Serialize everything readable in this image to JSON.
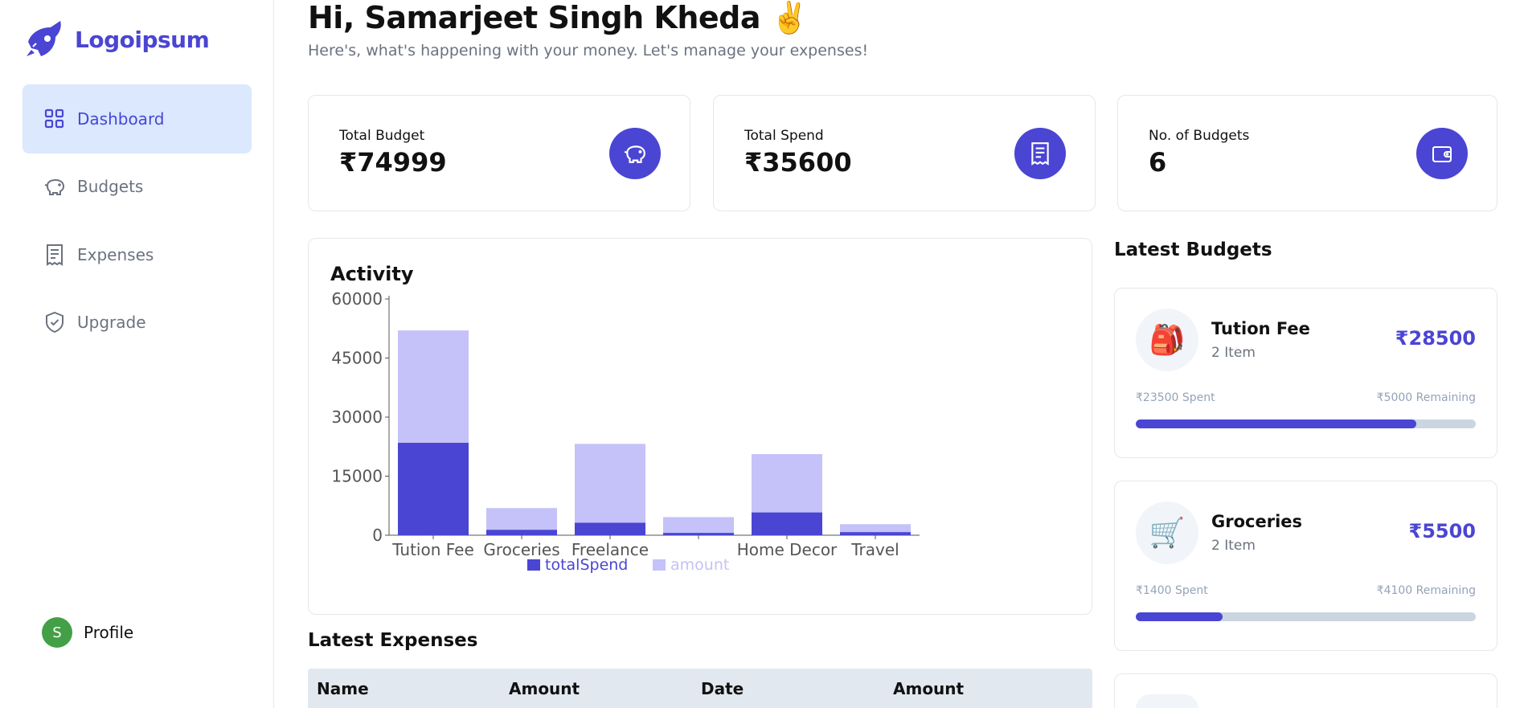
{
  "sidebar": {
    "logo_text": "Logoipsum",
    "nav": [
      {
        "label": "Dashboard",
        "icon": "grid-icon",
        "active": true
      },
      {
        "label": "Budgets",
        "icon": "piggy-bank-icon",
        "active": false
      },
      {
        "label": "Expenses",
        "icon": "receipt-icon",
        "active": false
      },
      {
        "label": "Upgrade",
        "icon": "shield-check-icon",
        "active": false
      }
    ],
    "profile": {
      "initial": "S",
      "label": "Profile"
    }
  },
  "header": {
    "greeting": "Hi, Samarjeet Singh Kheda ✌️",
    "subtitle": "Here's, what's happening with your money. Let's manage your expenses!"
  },
  "stats": [
    {
      "label": "Total Budget",
      "value": "₹74999",
      "icon": "piggy-bank-icon"
    },
    {
      "label": "Total Spend",
      "value": "₹35600",
      "icon": "receipt-icon"
    },
    {
      "label": "No. of Budgets",
      "value": "6",
      "icon": "wallet-icon"
    }
  ],
  "colors": {
    "accent": "#4a45d3",
    "accent_light": "#c4c2f8",
    "active_bg": "#dbe8fe"
  },
  "activity": {
    "title": "Activity"
  },
  "chart_data": {
    "type": "bar",
    "stacked": true,
    "categories": [
      "Tution Fee",
      "Groceries",
      "Freelance",
      "",
      "Home Decor",
      "Travel"
    ],
    "series": [
      {
        "name": "totalSpend",
        "color": "#4a45d3",
        "values": [
          23500,
          1400,
          3200,
          600,
          5800,
          800
        ]
      },
      {
        "name": "amount",
        "color": "#c4c2f8",
        "values": [
          28500,
          5500,
          20000,
          4000,
          14800,
          2000
        ]
      }
    ],
    "yticks": [
      "0",
      "15000",
      "30000",
      "45000",
      "60000"
    ],
    "ylim": [
      0,
      60000
    ],
    "legend_position": "bottom"
  },
  "latest_expenses": {
    "title": "Latest Expenses",
    "columns": [
      "Name",
      "Amount",
      "Date",
      "Amount"
    ]
  },
  "latest_budgets": {
    "title": "Latest Budgets",
    "items": [
      {
        "emoji": "🎒",
        "name": "Tution Fee",
        "items": "2 Item",
        "amount": "₹28500",
        "spent": "₹23500 Spent",
        "remaining": "₹5000 Remaining",
        "progress": 0.824
      },
      {
        "emoji": "🛒",
        "name": "Groceries",
        "items": "2 Item",
        "amount": "₹5500",
        "spent": "₹1400 Spent",
        "remaining": "₹4100 Remaining",
        "progress": 0.255
      }
    ]
  }
}
